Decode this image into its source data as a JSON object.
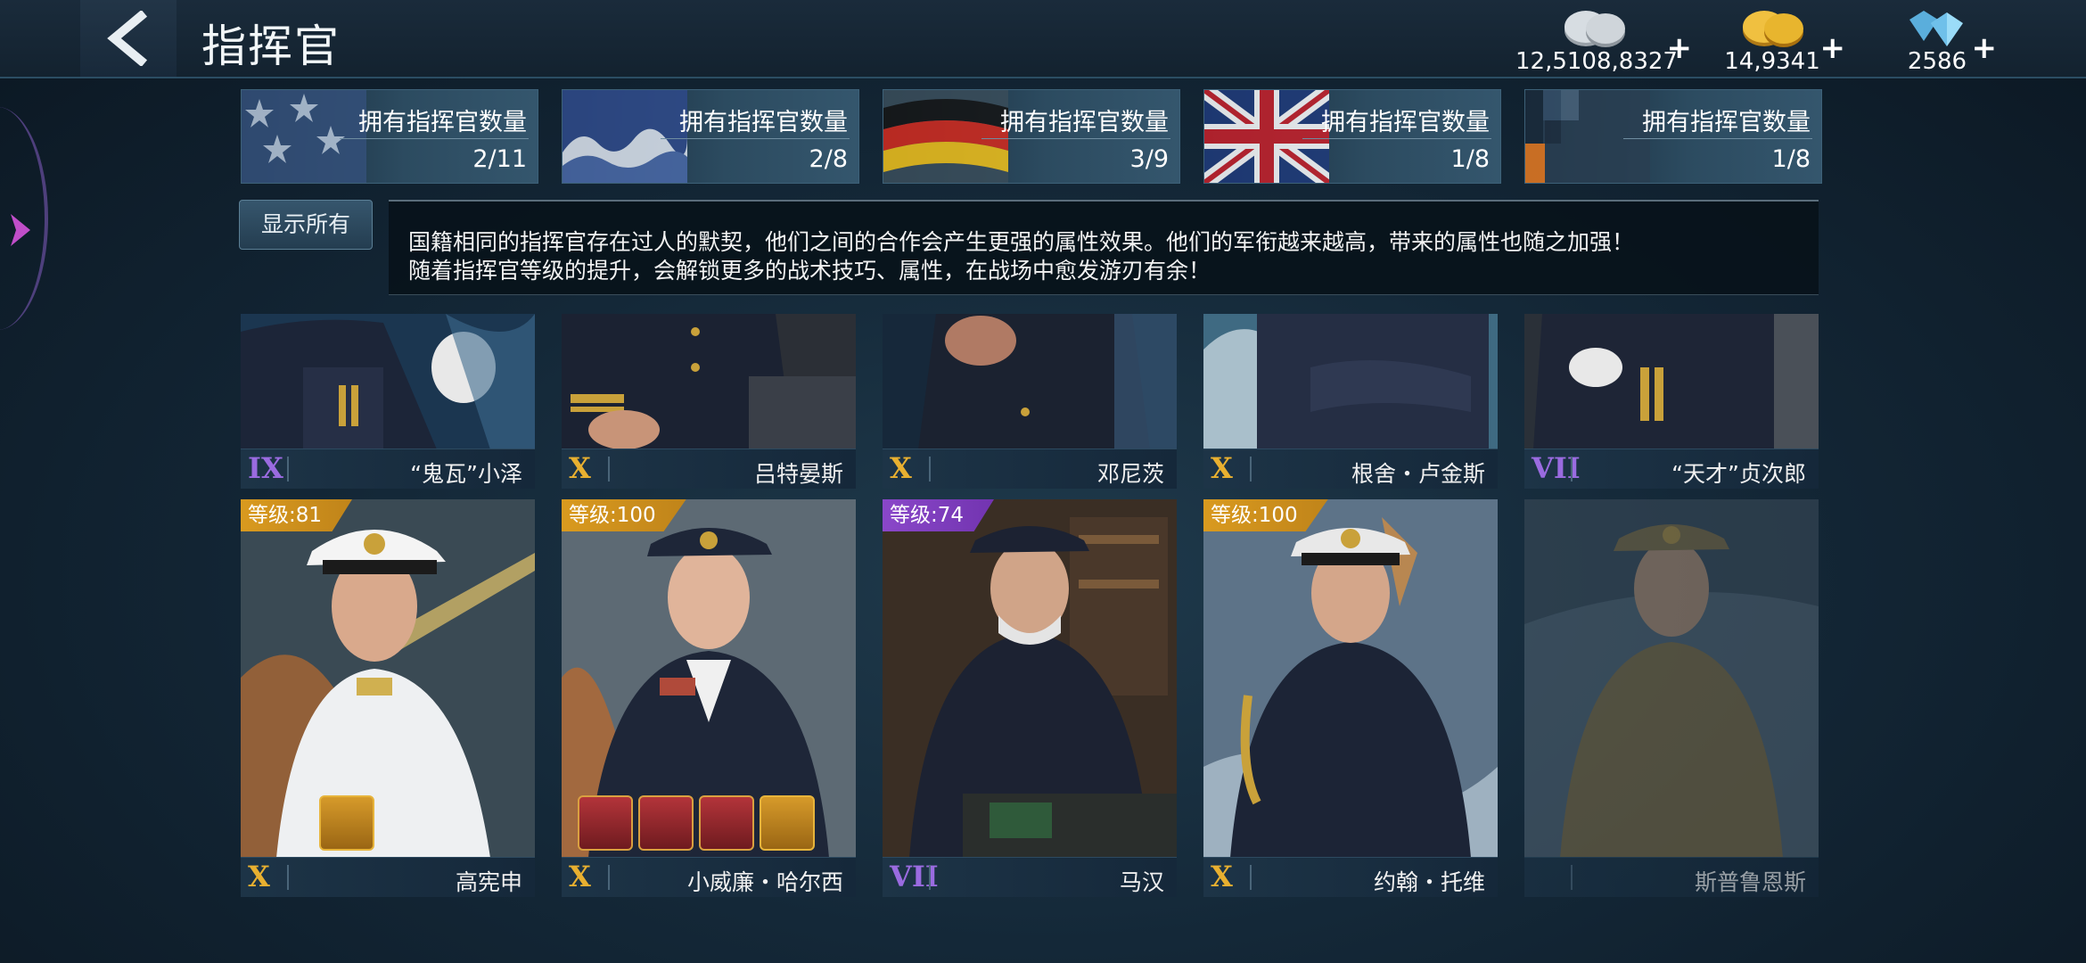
{
  "header": {
    "title": "指挥官"
  },
  "currencies": [
    {
      "name": "silver-coins",
      "value": "12,5108,8327",
      "plus": "+",
      "color": "#c9ced3"
    },
    {
      "name": "gold-coins",
      "value": "14,9341",
      "plus": "+",
      "color": "#e7b031"
    },
    {
      "name": "diamonds",
      "value": "2586",
      "plus": "+",
      "color": "#7ec8f0"
    }
  ],
  "nations": [
    {
      "label": "拥有指挥官数量",
      "count": "2/11",
      "flag": "usa"
    },
    {
      "label": "拥有指挥官数量",
      "count": "2/8",
      "flag": "japan"
    },
    {
      "label": "拥有指挥官数量",
      "count": "3/9",
      "flag": "germany"
    },
    {
      "label": "拥有指挥官数量",
      "count": "1/8",
      "flag": "uk"
    },
    {
      "label": "拥有指挥官数量",
      "count": "1/8",
      "flag": "other"
    }
  ],
  "show_all_label": "显示所有",
  "info": {
    "line1": "国籍相同的指挥官存在过人的默契，他们之间的合作会产生更强的属性效果。他们的军衔越来越高，带来的属性也随之加强！",
    "line2": "随着指挥官等级的提升，会解锁更多的战术技巧、属性，在战场中愈发游刃有余！"
  },
  "commanders_row1": [
    {
      "rank": "IX",
      "rank_color": "#9a6be0",
      "name": "“鬼瓦”小泽"
    },
    {
      "rank": "X",
      "rank_color": "#e8b030",
      "name": "吕特晏斯"
    },
    {
      "rank": "X",
      "rank_color": "#e8b030",
      "name": "邓尼茨"
    },
    {
      "rank": "X",
      "rank_color": "#e8b030",
      "name": "根舍・卢金斯"
    },
    {
      "rank": "VII",
      "rank_color": "#9a6be0",
      "name": "“天才”贞次郎"
    }
  ],
  "commanders_row2": [
    {
      "level": "等级:81",
      "level_style": "gold",
      "rank": "X",
      "rank_color": "#e8b030",
      "name": "高宪申",
      "equip_count": 1
    },
    {
      "level": "等级:100",
      "level_style": "gold",
      "rank": "X",
      "rank_color": "#e8b030",
      "name": "小威廉・哈尔西",
      "equip_count": 4
    },
    {
      "level": "等级:74",
      "level_style": "purple",
      "rank": "VII",
      "rank_color": "#9a6be0",
      "name": "马汉",
      "equip_count": 0
    },
    {
      "level": "等级:100",
      "level_style": "gold",
      "rank": "X",
      "rank_color": "#e8b030",
      "name": "约翰・托维",
      "equip_count": 0
    },
    {
      "level": "",
      "level_style": "none",
      "rank": "",
      "rank_color": "#777777",
      "name": "斯普鲁恩斯",
      "equip_count": 0,
      "locked": true
    }
  ]
}
